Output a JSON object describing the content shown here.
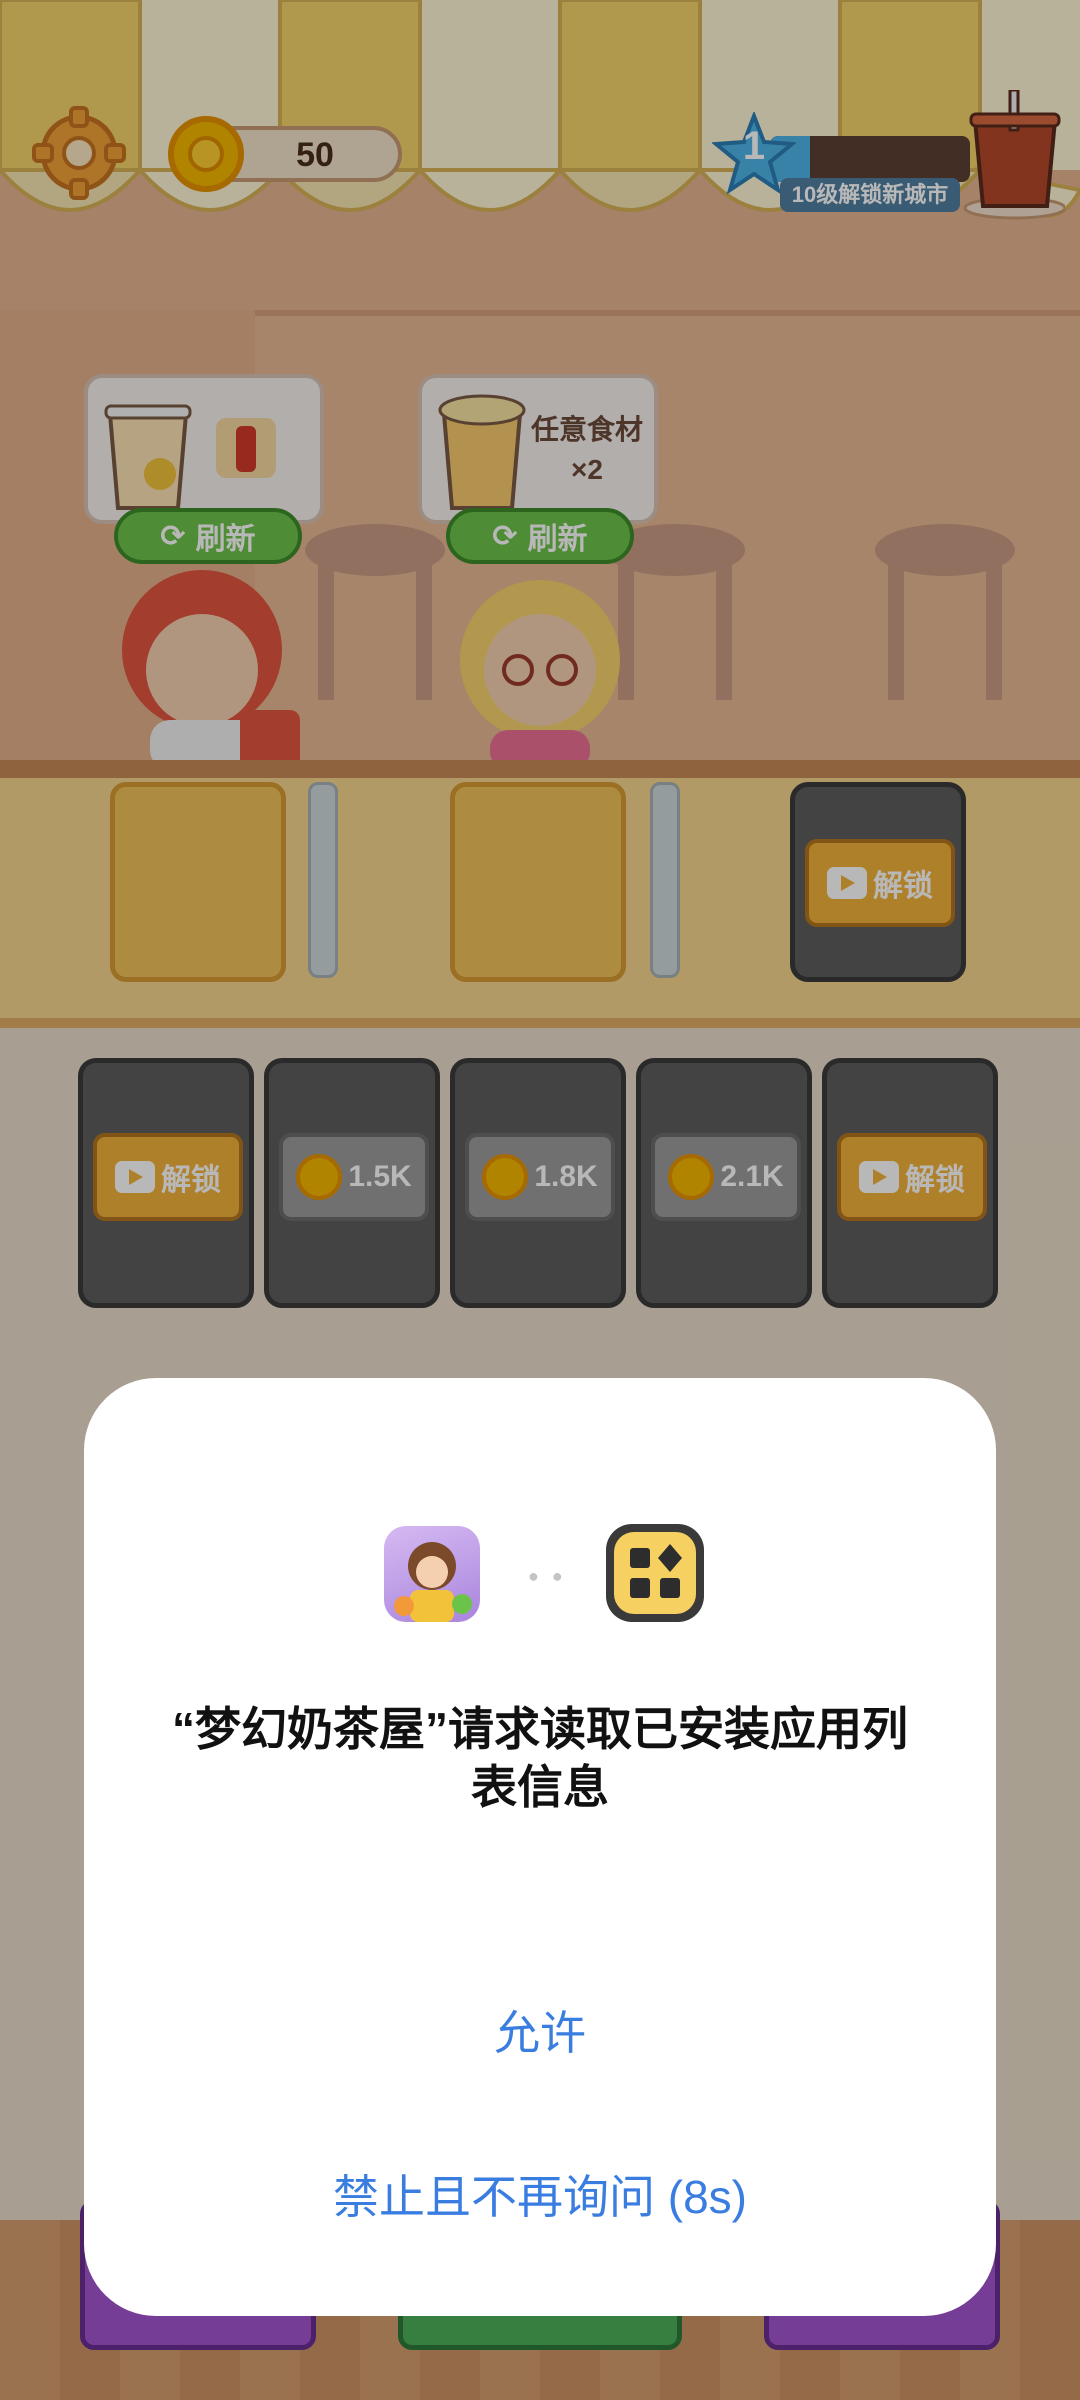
{
  "hud": {
    "coins": "50",
    "level": "1",
    "level_hint": "10级解锁新城市",
    "level_progress": 0.2
  },
  "customers": [
    {
      "refresh_label": "刷新"
    },
    {
      "order_text": "任意食材",
      "order_qty": "×2",
      "refresh_label": "刷新"
    }
  ],
  "counter_locked": {
    "unlock_label": "解锁"
  },
  "stations": [
    {
      "type": "unlock",
      "label": "解锁"
    },
    {
      "type": "price",
      "label": "1.5K"
    },
    {
      "type": "price",
      "label": "1.8K"
    },
    {
      "type": "price",
      "label": "2.1K"
    },
    {
      "type": "unlock",
      "label": "解锁"
    }
  ],
  "dialog": {
    "title": "“梦幻奶茶屋”请求读取已安装应用列表信息",
    "allow_label": "允许",
    "deny_label": "禁止且不再询问 (8s)"
  },
  "colors": {
    "accent_blue": "#3a7de0",
    "refresh_green": "#6cc34a",
    "unlock_orange": "#f3b23b"
  }
}
